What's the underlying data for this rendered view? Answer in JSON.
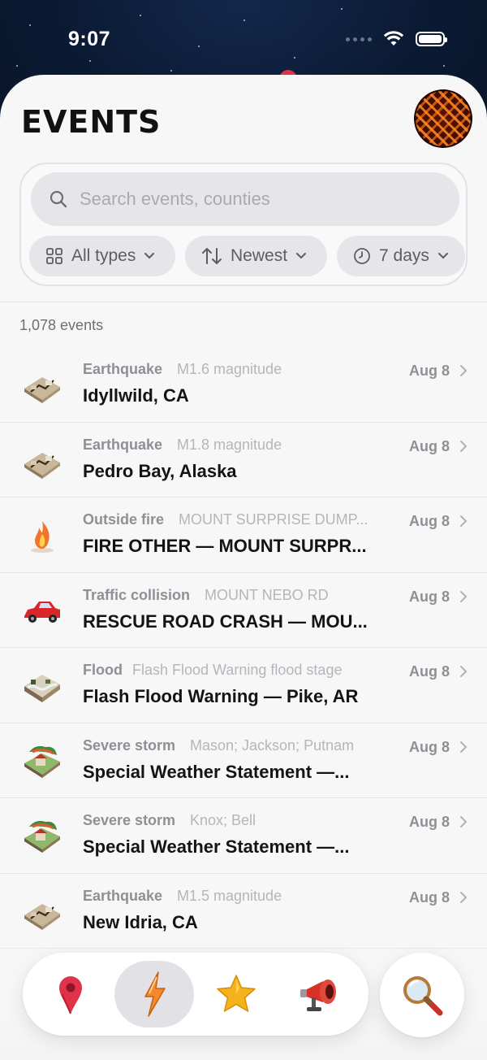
{
  "status_bar": {
    "time": "9:07"
  },
  "header": {
    "title": "EVENTS"
  },
  "search": {
    "placeholder": "Search events, counties"
  },
  "filters": {
    "type_label": "All types",
    "sort_label": "Newest",
    "range_label": "7 days"
  },
  "count_label": "1,078 events",
  "events": [
    {
      "icon": "earthquake-icon",
      "type": "Earthquake",
      "detail": "M1.6 magnitude",
      "title": "Idyllwild, CA",
      "date": "Aug 8"
    },
    {
      "icon": "earthquake-icon",
      "type": "Earthquake",
      "detail": "M1.8 magnitude",
      "title": "Pedro Bay, Alaska",
      "date": "Aug 8"
    },
    {
      "icon": "fire-icon",
      "type": "Outside fire",
      "detail": "MOUNT SURPRISE DUMP...",
      "title": "FIRE OTHER — MOUNT SURPR...",
      "date": "Aug 8"
    },
    {
      "icon": "car-crash-icon",
      "type": "Traffic collision",
      "detail": "MOUNT NEBO RD",
      "title": "RESCUE ROAD CRASH — MOU...",
      "date": "Aug 8"
    },
    {
      "icon": "flood-icon",
      "type": "Flood",
      "detail": "Flash Flood Warning flood stage",
      "title": "Flash Flood Warning — Pike, AR",
      "date": "Aug 8"
    },
    {
      "icon": "storm-icon",
      "type": "Severe storm",
      "detail": "Mason; Jackson; Putnam",
      "title": "Special Weather Statement —...",
      "date": "Aug 8"
    },
    {
      "icon": "storm-icon",
      "type": "Severe storm",
      "detail": "Knox; Bell",
      "title": "Special Weather Statement —...",
      "date": "Aug 8"
    },
    {
      "icon": "earthquake-icon",
      "type": "Earthquake",
      "detail": "M1.5 magnitude",
      "title": "New Idria, CA",
      "date": "Aug 8"
    }
  ],
  "tabbar": {
    "tabs": [
      "map-pin-icon",
      "lightning-icon",
      "star-icon",
      "megaphone-icon"
    ],
    "active": "lightning-icon",
    "search_button": "magnifier-icon"
  },
  "colors": {
    "accent": "#e0334a",
    "lightning": "#f08a2a",
    "star": "#f6b21b"
  }
}
